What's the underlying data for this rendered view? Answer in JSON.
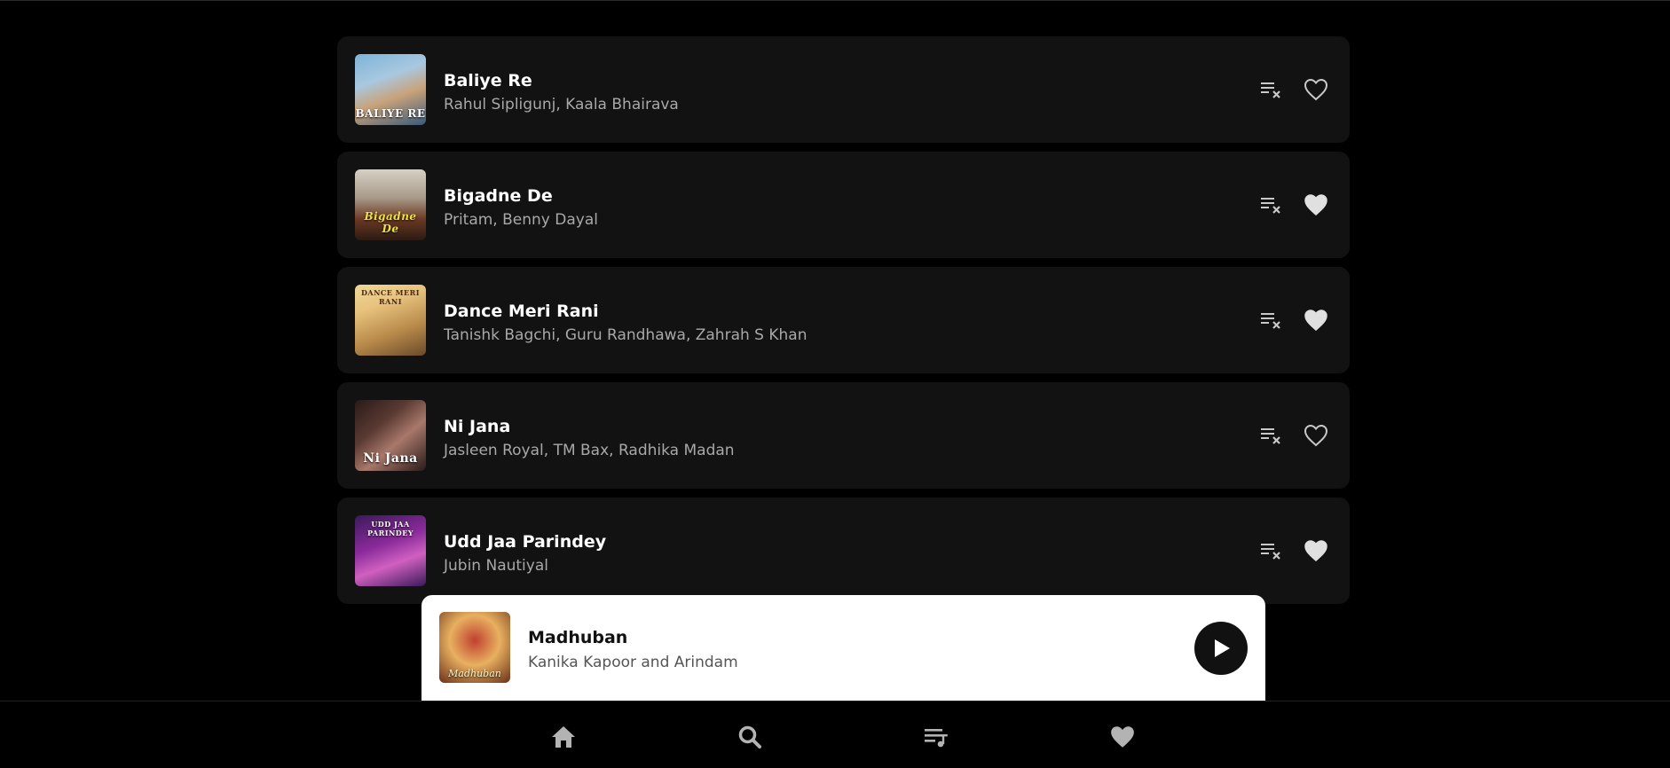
{
  "songs": [
    {
      "title": "Baliye Re",
      "artist": "Rahul Sipligunj, Kaala Bhairava",
      "liked": false,
      "cover_text": "BALIYE RE",
      "cover_colors": [
        "#7fb3d8",
        "#c9a27a",
        "#3a5a7a"
      ],
      "remove_icon": "playlist-remove-icon",
      "like_icon": "heart-outline-icon"
    },
    {
      "title": "Bigadne De",
      "artist": "Pritam, Benny Dayal",
      "liked": true,
      "cover_text": "Bigadne De",
      "cover_colors": [
        "#c9c0b4",
        "#6b3a22",
        "#2b1a12"
      ],
      "remove_icon": "playlist-remove-icon",
      "like_icon": "heart-filled-icon"
    },
    {
      "title": "Dance Meri Rani",
      "artist": "Tanishk Bagchi, Guru Randhawa, Zahrah S Khan",
      "liked": true,
      "cover_text": "DANCE MERI RANI",
      "cover_colors": [
        "#e7c27d",
        "#b88a4a",
        "#6a4a2a"
      ],
      "remove_icon": "playlist-remove-icon",
      "like_icon": "heart-filled-icon"
    },
    {
      "title": "Ni Jana",
      "artist": "Jasleen Royal, TM Bax, Radhika Madan",
      "liked": false,
      "cover_text": "Ni Jana",
      "cover_colors": [
        "#5a3a32",
        "#a8786a",
        "#2a1a18"
      ],
      "remove_icon": "playlist-remove-icon",
      "like_icon": "heart-outline-icon"
    },
    {
      "title": "Udd Jaa Parindey",
      "artist": "Jubin Nautiyal",
      "liked": true,
      "cover_text": "UDD JAA PARINDEY",
      "cover_colors": [
        "#8a2a9a",
        "#3a1a5a",
        "#d060c0"
      ],
      "remove_icon": "playlist-remove-icon",
      "like_icon": "heart-filled-icon"
    }
  ],
  "now_playing": {
    "title": "Madhuban",
    "artist": "Kanika Kapoor and Arindam",
    "cover_text": "Madhuban",
    "cover_colors": [
      "#e8b060",
      "#c04030",
      "#6a3018"
    ],
    "play_icon": "play-icon"
  },
  "nav": [
    {
      "icon": "home-icon"
    },
    {
      "icon": "search-icon"
    },
    {
      "icon": "playlist-icon"
    },
    {
      "icon": "heart-icon"
    }
  ],
  "colors": {
    "background": "#000000",
    "card": "#121212",
    "title": "#ffffff",
    "artist": "#a8a8a8",
    "icon": "#c8c8c8",
    "nav_icon": "#b3b3b3",
    "player_bg": "#ffffff"
  }
}
